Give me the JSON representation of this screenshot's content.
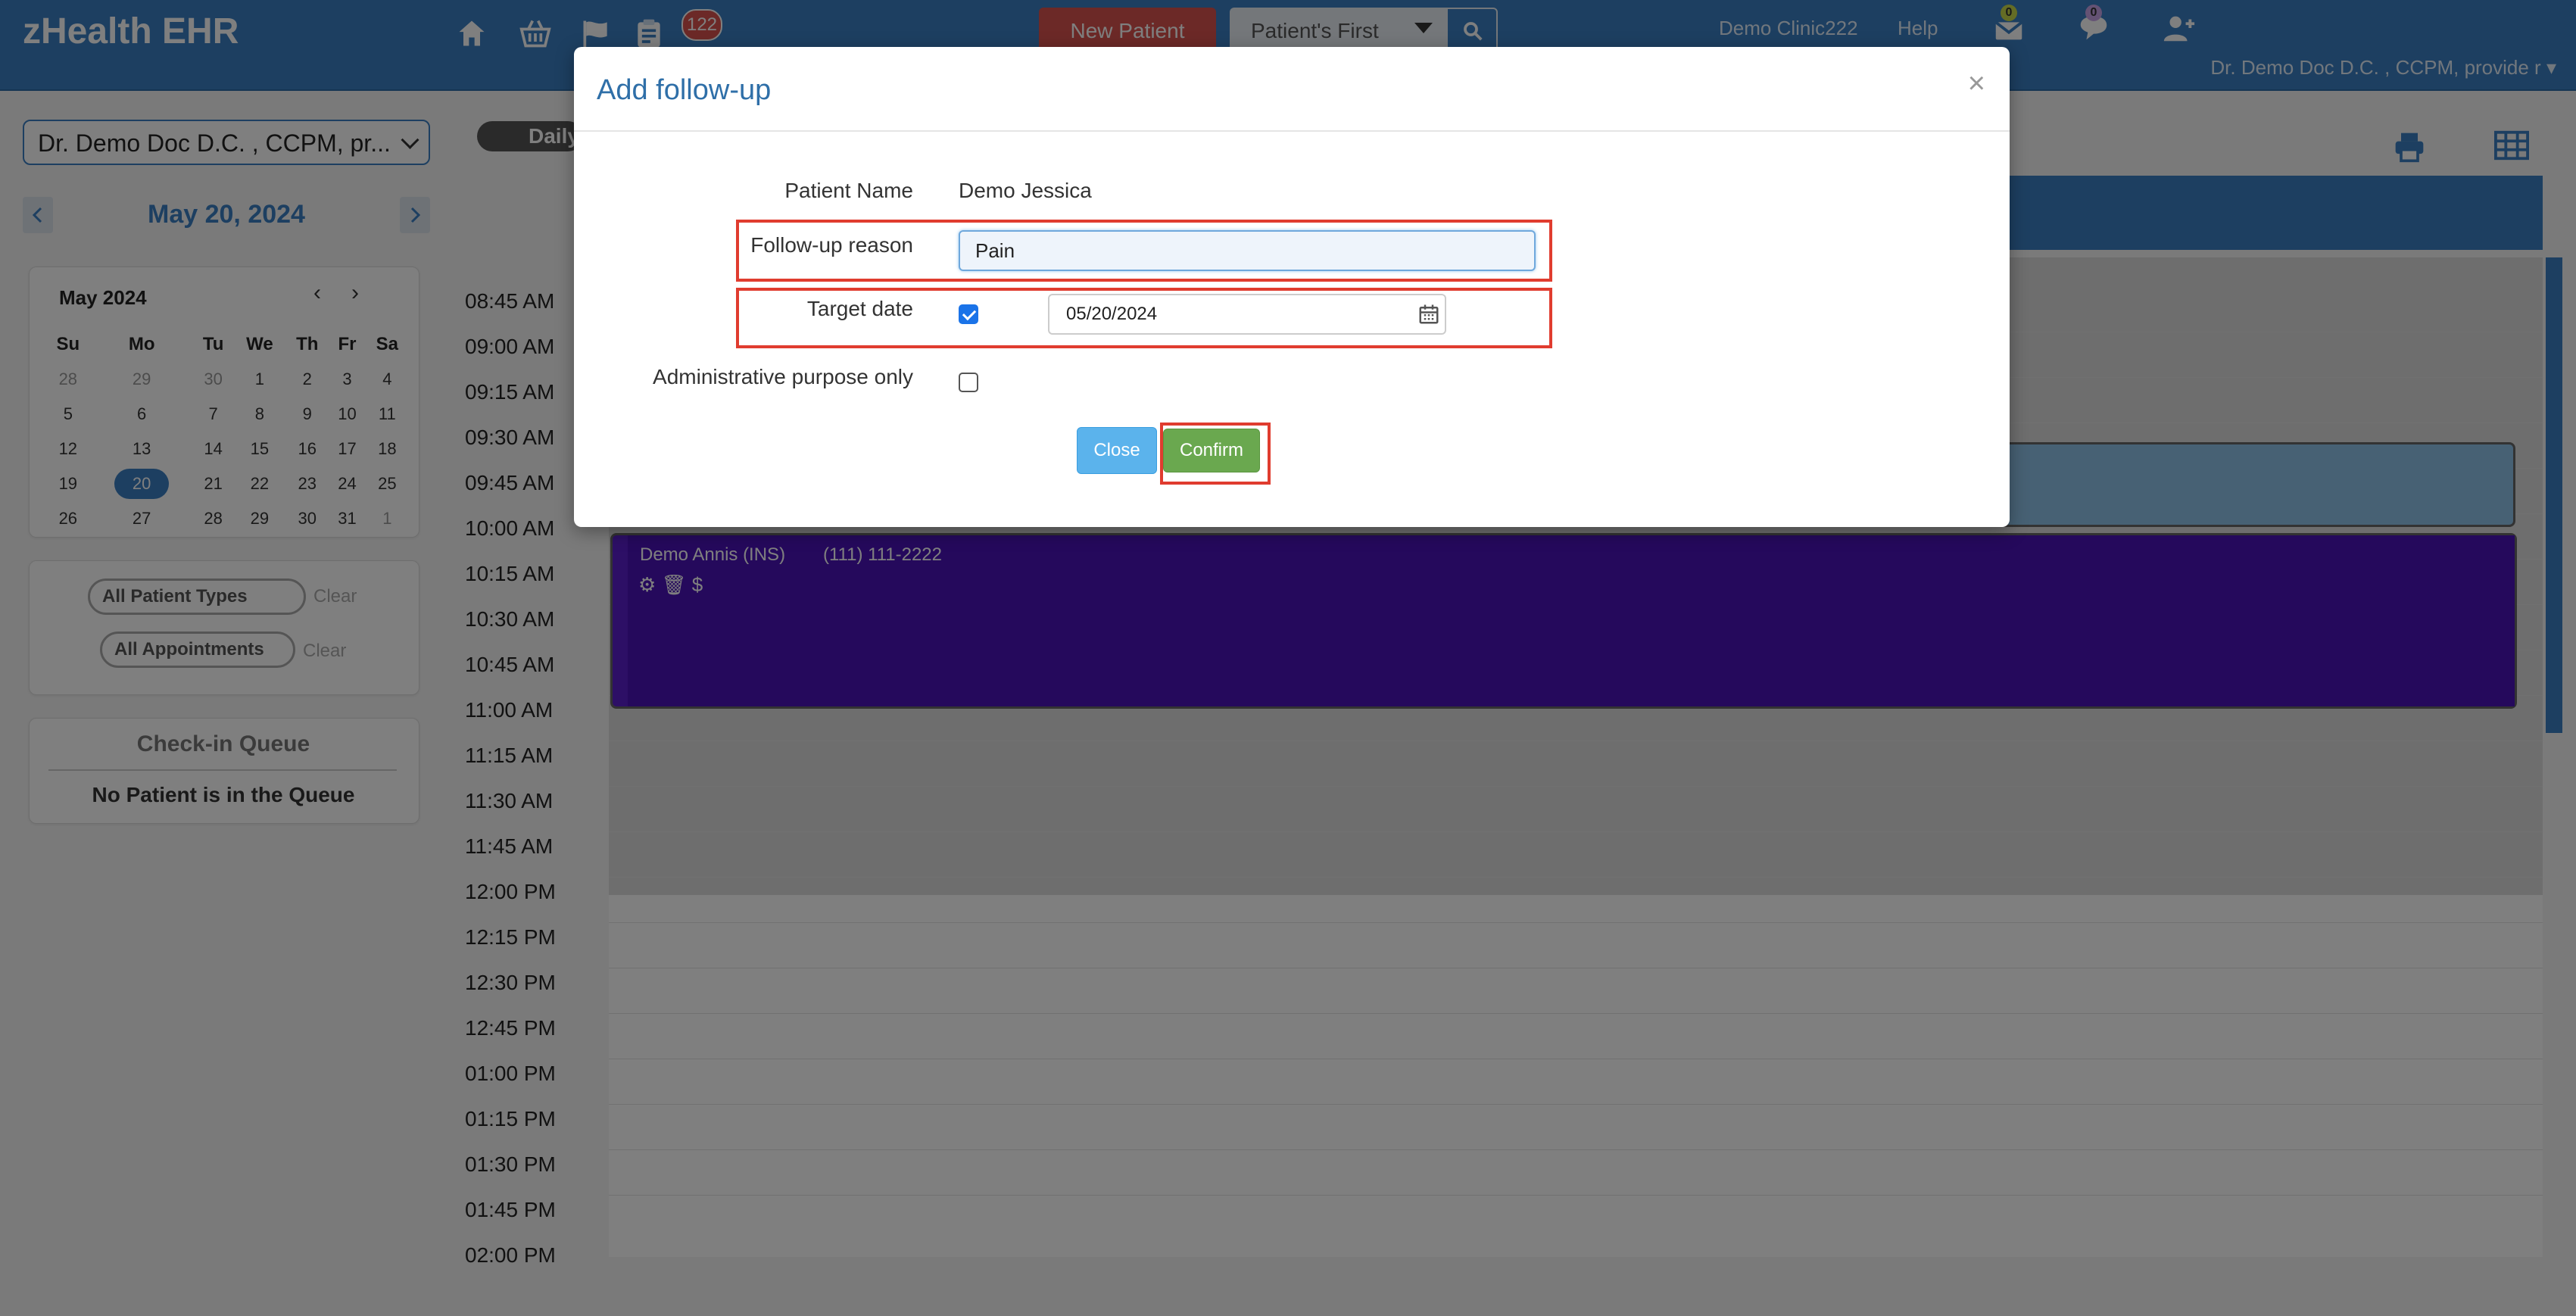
{
  "app": {
    "brand": "zHealth EHR",
    "notification_count": "122"
  },
  "header": {
    "new_patient": "New Patient",
    "search_mode": "Patient's First",
    "clinic": "Demo Clinic222",
    "help": "Help",
    "messages_count": "0",
    "chat_count": "0",
    "user": "Dr. Demo Doc D.C. , CCPM, provide r ▾"
  },
  "left": {
    "provider": "Dr. Demo Doc D.C. , CCPM, pr...",
    "current_date": "May 20, 2024",
    "calendar": {
      "month_label": "May 2024",
      "weekdays": [
        "Su",
        "Mo",
        "Tu",
        "We",
        "Th",
        "Fr",
        "Sa"
      ],
      "weeks": [
        [
          "28",
          "29",
          "30",
          "1",
          "2",
          "3",
          "4"
        ],
        [
          "5",
          "6",
          "7",
          "8",
          "9",
          "10",
          "11"
        ],
        [
          "12",
          "13",
          "14",
          "15",
          "16",
          "17",
          "18"
        ],
        [
          "19",
          "20",
          "21",
          "22",
          "23",
          "24",
          "25"
        ],
        [
          "26",
          "27",
          "28",
          "29",
          "30",
          "31",
          "1"
        ]
      ],
      "selected_day": "20"
    },
    "patient_types": "All Patient Types",
    "appointments": "All Appointments",
    "clear": "Clear",
    "queue_title": "Check-in Queue",
    "queue_empty": "No Patient is in the Queue"
  },
  "schedule": {
    "view": "Daily",
    "times": [
      "08:45 AM",
      "09:00 AM",
      "09:15 AM",
      "09:30 AM",
      "09:45 AM",
      "10:00 AM",
      "10:15 AM",
      "10:30 AM",
      "10:45 AM",
      "11:00 AM",
      "11:15 AM",
      "11:30 AM",
      "11:45 AM",
      "12:00 PM",
      "12:15 PM",
      "12:30 PM",
      "12:45 PM",
      "01:00 PM",
      "01:15 PM",
      "01:30 PM",
      "01:45 PM",
      "02:00 PM"
    ],
    "appointment": {
      "name": "Demo Annis (INS)",
      "phone": "(111) 111-2222",
      "icons": "⚙  🗑  $"
    },
    "colors": {
      "header": "#3a7fc2",
      "purple_appt": "#4a13b8",
      "light_appt": "#8fc2e8"
    }
  },
  "modal": {
    "title": "Add follow-up",
    "close_x": "×",
    "patient_name_label": "Patient Name",
    "patient_name": "Demo Jessica",
    "reason_label": "Follow-up reason",
    "reason_value": "Pain",
    "target_date_label": "Target date",
    "target_date_checked": true,
    "target_date_value": "05/20/2024",
    "admin_label": "Administrative purpose only",
    "admin_checked": false,
    "close_button": "Close",
    "confirm_button": "Confirm",
    "highlight_color": "#e03c2f"
  }
}
